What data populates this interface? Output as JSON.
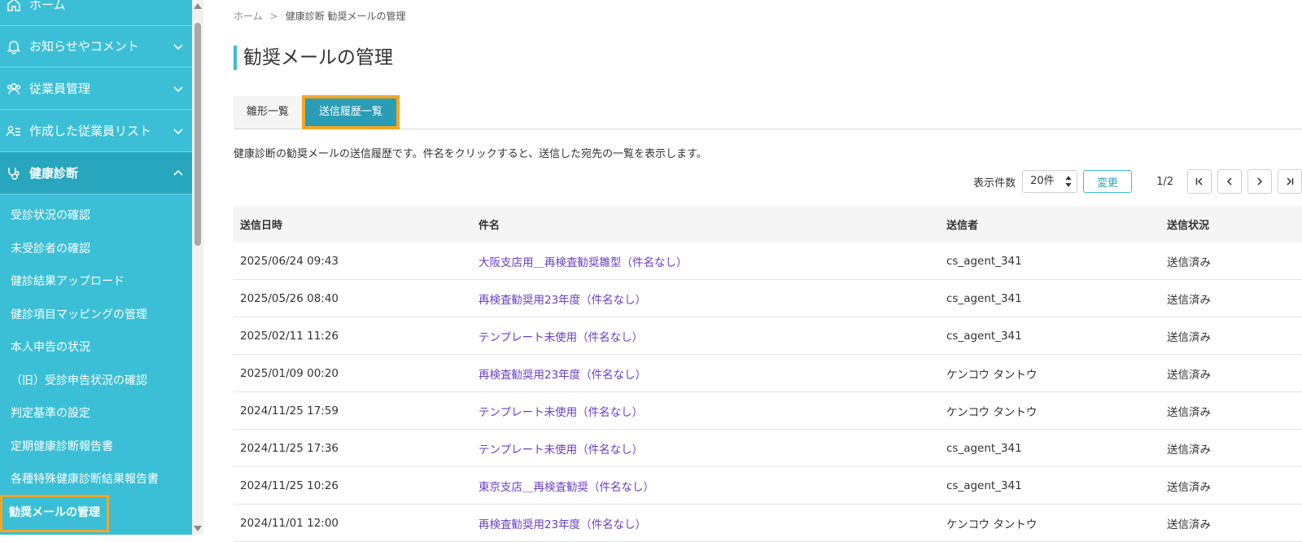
{
  "sidebar": {
    "home_label": "ホーム",
    "menu": [
      {
        "label": "お知らせやコメント",
        "icon": "bell-icon"
      },
      {
        "label": "従業員管理",
        "icon": "users-icon"
      },
      {
        "label": "作成した従業員リスト",
        "icon": "user-list-icon"
      },
      {
        "label": "健康診断",
        "icon": "stethoscope-icon"
      }
    ],
    "sub_items": [
      "受診状況の確認",
      "未受診者の確認",
      "健診結果アップロード",
      "健診項目マッピングの管理",
      "本人申告の状況",
      "（旧）受診申告状況の確認",
      "判定基準の設定",
      "定期健康診断報告書",
      "各種特殊健康診断結果報告書",
      "勧奨メールの管理"
    ]
  },
  "breadcrumb": {
    "home": "ホーム",
    "separator": ">",
    "current": "健康診断 勧奨メールの管理"
  },
  "page_title": "勧奨メールの管理",
  "tabs": {
    "templates": "雛形一覧",
    "history": "送信履歴一覧"
  },
  "description": "健康診断の勧奨メールの送信履歴です。件名をクリックすると、送信した宛先の一覧を表示します。",
  "controls": {
    "page_size_label": "表示件数",
    "page_size_value": "20件",
    "change_label": "変更",
    "page_indicator": "1/2"
  },
  "table": {
    "headers": [
      "送信日時",
      "件名",
      "送信者",
      "送信状況"
    ],
    "rows": [
      [
        "2025/06/24 09:43",
        "大阪支店用＿再検査勧奨雛型（件名なし）",
        "cs_agent_341",
        "送信済み"
      ],
      [
        "2025/05/26 08:40",
        "再検査勧奨用23年度（件名なし）",
        "cs_agent_341",
        "送信済み"
      ],
      [
        "2025/02/11 11:26",
        "テンプレート未使用（件名なし）",
        "cs_agent_341",
        "送信済み"
      ],
      [
        "2025/01/09 00:20",
        "再検査勧奨用23年度（件名なし）",
        "ケンコウ タントウ",
        "送信済み"
      ],
      [
        "2024/11/25 17:59",
        "テンプレート未使用（件名なし）",
        "ケンコウ タントウ",
        "送信済み"
      ],
      [
        "2024/11/25 17:36",
        "テンプレート未使用（件名なし）",
        "cs_agent_341",
        "送信済み"
      ],
      [
        "2024/11/25 10:26",
        "東京支店＿再検査勧奨（件名なし）",
        "cs_agent_341",
        "送信済み"
      ],
      [
        "2024/11/01 12:00",
        "再検査勧奨用23年度（件名なし）",
        "ケンコウ タントウ",
        "送信済み"
      ]
    ]
  },
  "colors": {
    "sidebar": "#3bbfd6",
    "sidebar_active": "#27a6bd",
    "tab_active": "#2a9db4",
    "highlight": "#f5a623",
    "link": "#6a3fc7"
  }
}
